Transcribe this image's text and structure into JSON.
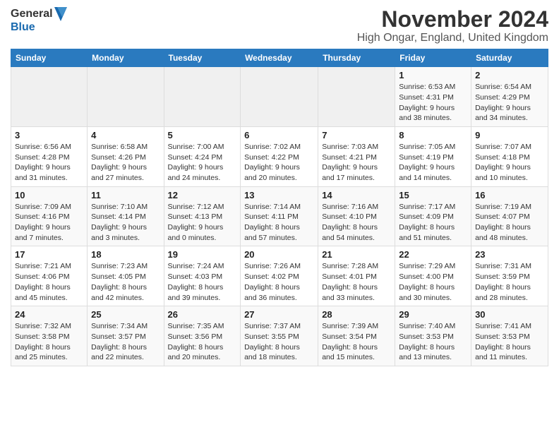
{
  "header": {
    "logo_text_general": "General",
    "logo_text_blue": "Blue",
    "month_title": "November 2024",
    "location": "High Ongar, England, United Kingdom"
  },
  "weekdays": [
    "Sunday",
    "Monday",
    "Tuesday",
    "Wednesday",
    "Thursday",
    "Friday",
    "Saturday"
  ],
  "weeks": [
    [
      {
        "day": "",
        "info": ""
      },
      {
        "day": "",
        "info": ""
      },
      {
        "day": "",
        "info": ""
      },
      {
        "day": "",
        "info": ""
      },
      {
        "day": "",
        "info": ""
      },
      {
        "day": "1",
        "info": "Sunrise: 6:53 AM\nSunset: 4:31 PM\nDaylight: 9 hours\nand 38 minutes."
      },
      {
        "day": "2",
        "info": "Sunrise: 6:54 AM\nSunset: 4:29 PM\nDaylight: 9 hours\nand 34 minutes."
      }
    ],
    [
      {
        "day": "3",
        "info": "Sunrise: 6:56 AM\nSunset: 4:28 PM\nDaylight: 9 hours\nand 31 minutes."
      },
      {
        "day": "4",
        "info": "Sunrise: 6:58 AM\nSunset: 4:26 PM\nDaylight: 9 hours\nand 27 minutes."
      },
      {
        "day": "5",
        "info": "Sunrise: 7:00 AM\nSunset: 4:24 PM\nDaylight: 9 hours\nand 24 minutes."
      },
      {
        "day": "6",
        "info": "Sunrise: 7:02 AM\nSunset: 4:22 PM\nDaylight: 9 hours\nand 20 minutes."
      },
      {
        "day": "7",
        "info": "Sunrise: 7:03 AM\nSunset: 4:21 PM\nDaylight: 9 hours\nand 17 minutes."
      },
      {
        "day": "8",
        "info": "Sunrise: 7:05 AM\nSunset: 4:19 PM\nDaylight: 9 hours\nand 14 minutes."
      },
      {
        "day": "9",
        "info": "Sunrise: 7:07 AM\nSunset: 4:18 PM\nDaylight: 9 hours\nand 10 minutes."
      }
    ],
    [
      {
        "day": "10",
        "info": "Sunrise: 7:09 AM\nSunset: 4:16 PM\nDaylight: 9 hours\nand 7 minutes."
      },
      {
        "day": "11",
        "info": "Sunrise: 7:10 AM\nSunset: 4:14 PM\nDaylight: 9 hours\nand 3 minutes."
      },
      {
        "day": "12",
        "info": "Sunrise: 7:12 AM\nSunset: 4:13 PM\nDaylight: 9 hours\nand 0 minutes."
      },
      {
        "day": "13",
        "info": "Sunrise: 7:14 AM\nSunset: 4:11 PM\nDaylight: 8 hours\nand 57 minutes."
      },
      {
        "day": "14",
        "info": "Sunrise: 7:16 AM\nSunset: 4:10 PM\nDaylight: 8 hours\nand 54 minutes."
      },
      {
        "day": "15",
        "info": "Sunrise: 7:17 AM\nSunset: 4:09 PM\nDaylight: 8 hours\nand 51 minutes."
      },
      {
        "day": "16",
        "info": "Sunrise: 7:19 AM\nSunset: 4:07 PM\nDaylight: 8 hours\nand 48 minutes."
      }
    ],
    [
      {
        "day": "17",
        "info": "Sunrise: 7:21 AM\nSunset: 4:06 PM\nDaylight: 8 hours\nand 45 minutes."
      },
      {
        "day": "18",
        "info": "Sunrise: 7:23 AM\nSunset: 4:05 PM\nDaylight: 8 hours\nand 42 minutes."
      },
      {
        "day": "19",
        "info": "Sunrise: 7:24 AM\nSunset: 4:03 PM\nDaylight: 8 hours\nand 39 minutes."
      },
      {
        "day": "20",
        "info": "Sunrise: 7:26 AM\nSunset: 4:02 PM\nDaylight: 8 hours\nand 36 minutes."
      },
      {
        "day": "21",
        "info": "Sunrise: 7:28 AM\nSunset: 4:01 PM\nDaylight: 8 hours\nand 33 minutes."
      },
      {
        "day": "22",
        "info": "Sunrise: 7:29 AM\nSunset: 4:00 PM\nDaylight: 8 hours\nand 30 minutes."
      },
      {
        "day": "23",
        "info": "Sunrise: 7:31 AM\nSunset: 3:59 PM\nDaylight: 8 hours\nand 28 minutes."
      }
    ],
    [
      {
        "day": "24",
        "info": "Sunrise: 7:32 AM\nSunset: 3:58 PM\nDaylight: 8 hours\nand 25 minutes."
      },
      {
        "day": "25",
        "info": "Sunrise: 7:34 AM\nSunset: 3:57 PM\nDaylight: 8 hours\nand 22 minutes."
      },
      {
        "day": "26",
        "info": "Sunrise: 7:35 AM\nSunset: 3:56 PM\nDaylight: 8 hours\nand 20 minutes."
      },
      {
        "day": "27",
        "info": "Sunrise: 7:37 AM\nSunset: 3:55 PM\nDaylight: 8 hours\nand 18 minutes."
      },
      {
        "day": "28",
        "info": "Sunrise: 7:39 AM\nSunset: 3:54 PM\nDaylight: 8 hours\nand 15 minutes."
      },
      {
        "day": "29",
        "info": "Sunrise: 7:40 AM\nSunset: 3:53 PM\nDaylight: 8 hours\nand 13 minutes."
      },
      {
        "day": "30",
        "info": "Sunrise: 7:41 AM\nSunset: 3:53 PM\nDaylight: 8 hours\nand 11 minutes."
      }
    ]
  ]
}
